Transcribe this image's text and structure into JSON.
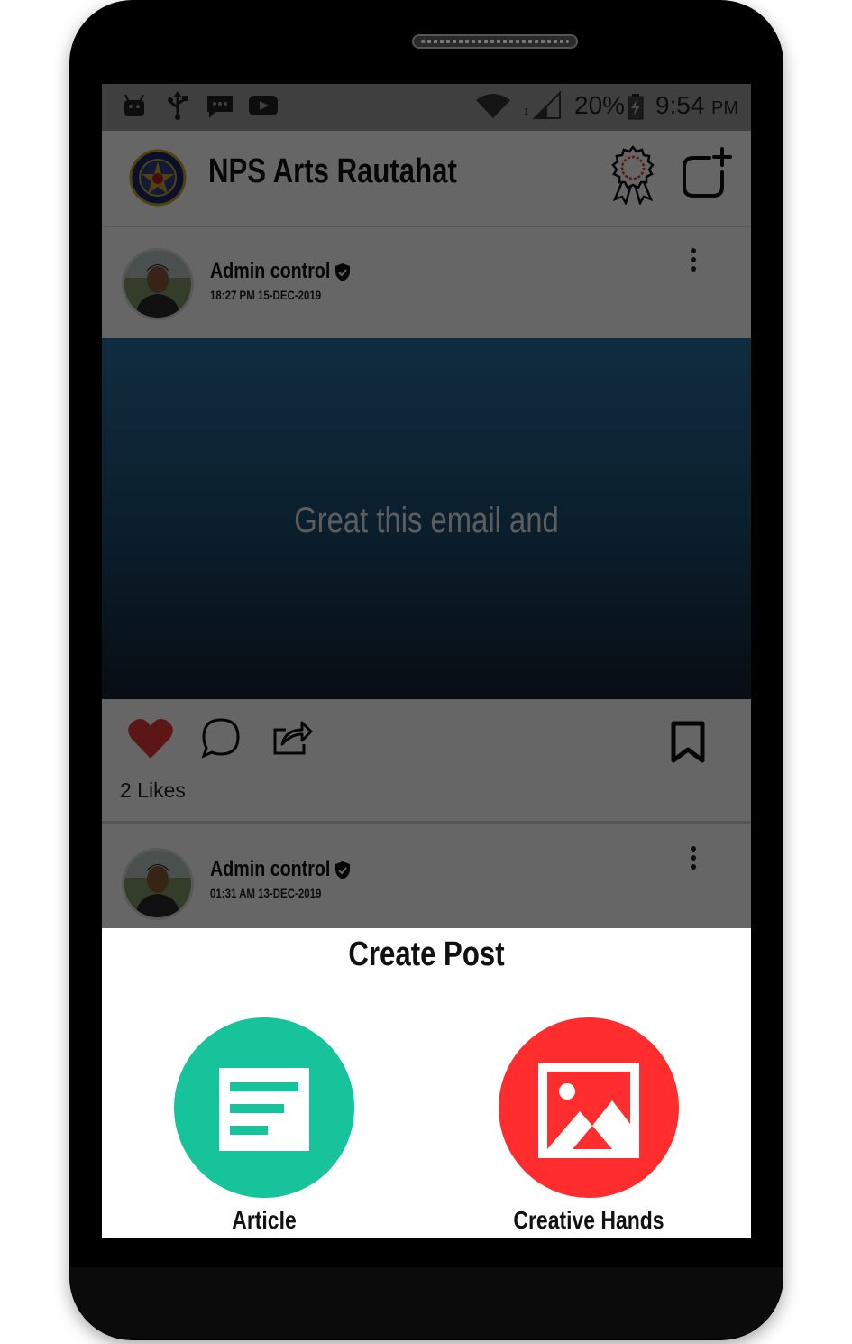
{
  "status_bar": {
    "battery": "20%",
    "time": "9:54",
    "ampm": "PM",
    "signal_sub": "1"
  },
  "app_bar": {
    "title": "NPS Arts Rautahat"
  },
  "posts": [
    {
      "author": "Admin control",
      "timestamp": "18:27 PM 15-DEC-2019",
      "media_text": "Great this email and",
      "likes": "2 Likes"
    },
    {
      "author": "Admin control",
      "timestamp": "01:31 AM 13-DEC-2019"
    }
  ],
  "sheet": {
    "title": "Create Post",
    "options": [
      {
        "label": "Article",
        "color": "#16c39a"
      },
      {
        "label": "Creative Hands",
        "color": "#ff2d2d"
      }
    ]
  },
  "colors": {
    "like": "#e53935",
    "media_top": "#2a6f9e",
    "media_bottom": "#152230"
  }
}
